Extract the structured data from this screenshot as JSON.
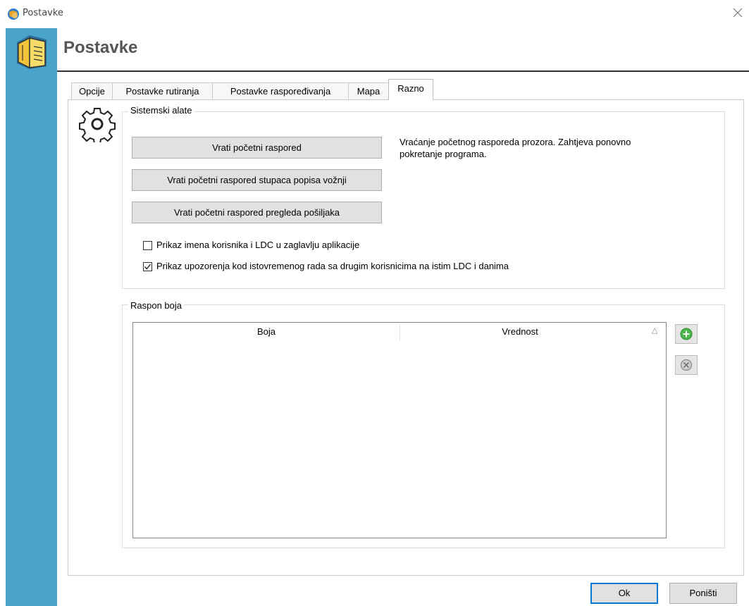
{
  "window": {
    "title": "Postavke"
  },
  "header": {
    "title": "Postavke"
  },
  "tabs": [
    {
      "label": "Opcije"
    },
    {
      "label": "Postavke rutiranja"
    },
    {
      "label": "Postavke raspoređivanja"
    },
    {
      "label": "Mapa"
    },
    {
      "label": "Razno"
    }
  ],
  "active_tab": "Razno",
  "system_tools": {
    "title": "Sistemski alate",
    "buttons": [
      {
        "label": "Vrati početni raspored"
      },
      {
        "label": "Vrati početni raspored stupaca popisa vožnji"
      },
      {
        "label": "Vrati početni raspored pregleda pošiljaka"
      }
    ],
    "description": "Vraćanje početnog rasporeda prozora. Zahtjeva ponovno pokretanje programa.",
    "checkboxes": [
      {
        "label": "Prikaz imena korisnika i LDC u zaglavlju aplikacije",
        "checked": false
      },
      {
        "label": "Prikaz upozorenja kod istovremenog rada sa drugim korisnicima na istim LDC i danima",
        "checked": true
      }
    ]
  },
  "color_range": {
    "title": "Raspon boja",
    "columns": [
      {
        "label": "Boja"
      },
      {
        "label": "Vrednost"
      }
    ],
    "sort_indicator": "△",
    "rows": []
  },
  "icons": {
    "app": "app-globe-icon",
    "sidebar": "book-icon",
    "tools": "gear-icon",
    "add": "add-icon",
    "remove": "remove-icon",
    "close": "close-icon"
  },
  "footer": {
    "ok_label": "Ok",
    "cancel_label": "Poništi"
  }
}
